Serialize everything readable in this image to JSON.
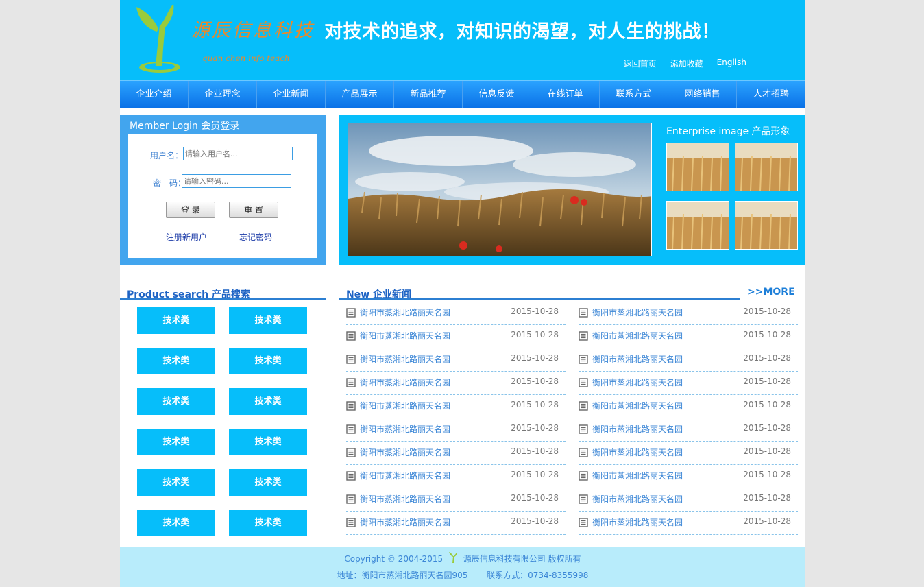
{
  "header": {
    "logo_cn": "源辰信息科技",
    "logo_en": "quan chen info teach",
    "slogan": "对技术的追求，对知识的渴望，对人生的挑战！",
    "links": [
      "返回首页",
      "添加收藏",
      "English"
    ]
  },
  "nav": [
    "企业介绍",
    "企业理念",
    "企业新闻",
    "产品展示",
    "新品推荐",
    "信息反馈",
    "在线订单",
    "联系方式",
    "网络销售",
    "人才招聘"
  ],
  "login": {
    "title": "Member Login 会员登录",
    "username_label": "用户名：",
    "username_placeholder": "请输入用户名...",
    "password_label": "密　码：",
    "password_placeholder": "请输入密码...",
    "login_button": "登 录",
    "reset_button": "重 置",
    "register_link": "注册新用户",
    "forgot_link": "忘记密码"
  },
  "enterprise": {
    "title": "Enterprise image 产品形象"
  },
  "product_search": {
    "title": "Product search 产品搜索",
    "tags": [
      "技术类",
      "技术类",
      "技术类",
      "技术类",
      "技术类",
      "技术类",
      "技术类",
      "技术类",
      "技术类",
      "技术类",
      "技术类",
      "技术类"
    ]
  },
  "news": {
    "title": "New 企业新闻",
    "more": ">>MORE",
    "left": [
      {
        "text": "衡阳市蒸湘北路丽天名园",
        "date": "2015-10-28"
      },
      {
        "text": "衡阳市蒸湘北路丽天名园",
        "date": "2015-10-28"
      },
      {
        "text": "衡阳市蒸湘北路丽天名园",
        "date": "2015-10-28"
      },
      {
        "text": "衡阳市蒸湘北路丽天名园",
        "date": "2015-10-28"
      },
      {
        "text": "衡阳市蒸湘北路丽天名园",
        "date": "2015-10-28"
      },
      {
        "text": "衡阳市蒸湘北路丽天名园",
        "date": "2015-10-28"
      },
      {
        "text": "衡阳市蒸湘北路丽天名园",
        "date": "2015-10-28"
      },
      {
        "text": "衡阳市蒸湘北路丽天名园",
        "date": "2015-10-28"
      },
      {
        "text": "衡阳市蒸湘北路丽天名园",
        "date": "2015-10-28"
      },
      {
        "text": "衡阳市蒸湘北路丽天名园",
        "date": "2015-10-28"
      }
    ],
    "right": [
      {
        "text": "衡阳市蒸湘北路丽天名园",
        "date": "2015-10-28"
      },
      {
        "text": "衡阳市蒸湘北路丽天名园",
        "date": "2015-10-28"
      },
      {
        "text": "衡阳市蒸湘北路丽天名园",
        "date": "2015-10-28"
      },
      {
        "text": "衡阳市蒸湘北路丽天名园",
        "date": "2015-10-28"
      },
      {
        "text": "衡阳市蒸湘北路丽天名园",
        "date": "2015-10-28"
      },
      {
        "text": "衡阳市蒸湘北路丽天名园",
        "date": "2015-10-28"
      },
      {
        "text": "衡阳市蒸湘北路丽天名园",
        "date": "2015-10-28"
      },
      {
        "text": "衡阳市蒸湘北路丽天名园",
        "date": "2015-10-28"
      },
      {
        "text": "衡阳市蒸湘北路丽天名园",
        "date": "2015-10-28"
      },
      {
        "text": "衡阳市蒸湘北路丽天名园",
        "date": "2015-10-28"
      }
    ]
  },
  "footer": {
    "copyright": "Copyright © 2004-2015",
    "company": "源辰信息科技有限公司 版权所有",
    "address": "地址：衡阳市蒸湘北路丽天名园905",
    "contact": "联系方式：0734-8355998"
  },
  "colors": {
    "primary": "#06befa",
    "nav": "#0a70e6",
    "link": "#3b86d6",
    "title": "#1e63c4",
    "logo": "#e8892c",
    "footer_bg": "#b8ecfb"
  }
}
